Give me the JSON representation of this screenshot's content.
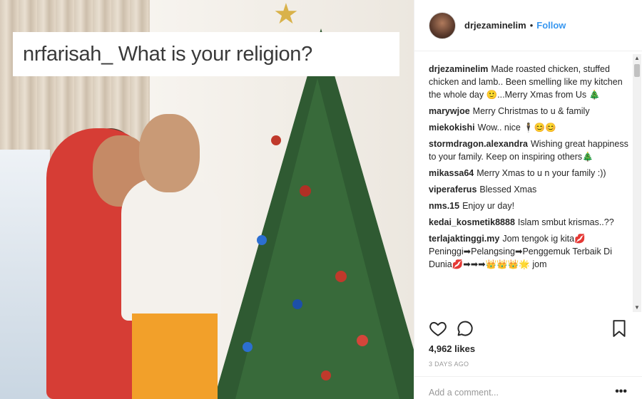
{
  "photo": {
    "caption_overlay": "nrfarisah_ What is your religion?"
  },
  "post": {
    "username": "drjezaminelim",
    "separator": "•",
    "follow_label": "Follow"
  },
  "comments": [
    {
      "user": "drjezaminelim",
      "text": "Made roasted chicken, stuffed chicken and lamb.. Been smelling like my kitchen the whole day 🙂...Merry Xmas from Us 🎄"
    },
    {
      "user": "marywjoe",
      "text": "Merry Christmas to u & family"
    },
    {
      "user": "miekokishi",
      "text": "Wow.. nice 🕴😊😊"
    },
    {
      "user": "stormdragon.alexandra",
      "text": "Wishing great happiness to your family. Keep on inspiring others🎄"
    },
    {
      "user": "mikassa64",
      "text": "Merry Xmas to u n your family :))"
    },
    {
      "user": "viperaferus",
      "text": "Blessed Xmas"
    },
    {
      "user": "nms.15",
      "text": "Enjoy ur day!"
    },
    {
      "user": "kedai_kosmetik8888",
      "text": "Islam smbut krismas..??"
    },
    {
      "user": "terlajaktinggi.my",
      "text": "Jom tengok ig kita💋 Peninggi➡Pelangsing➡Penggemuk Terbaik Di Dunia💋➡➡➡👑👑👑🌟 jom"
    }
  ],
  "likes_text": "4,962 likes",
  "time_text": "3 DAYS AGO",
  "add_comment_placeholder": "Add a comment...",
  "more_label": "•••",
  "colors": {
    "link": "#3897f0",
    "text": "#262626",
    "muted": "#999999"
  }
}
